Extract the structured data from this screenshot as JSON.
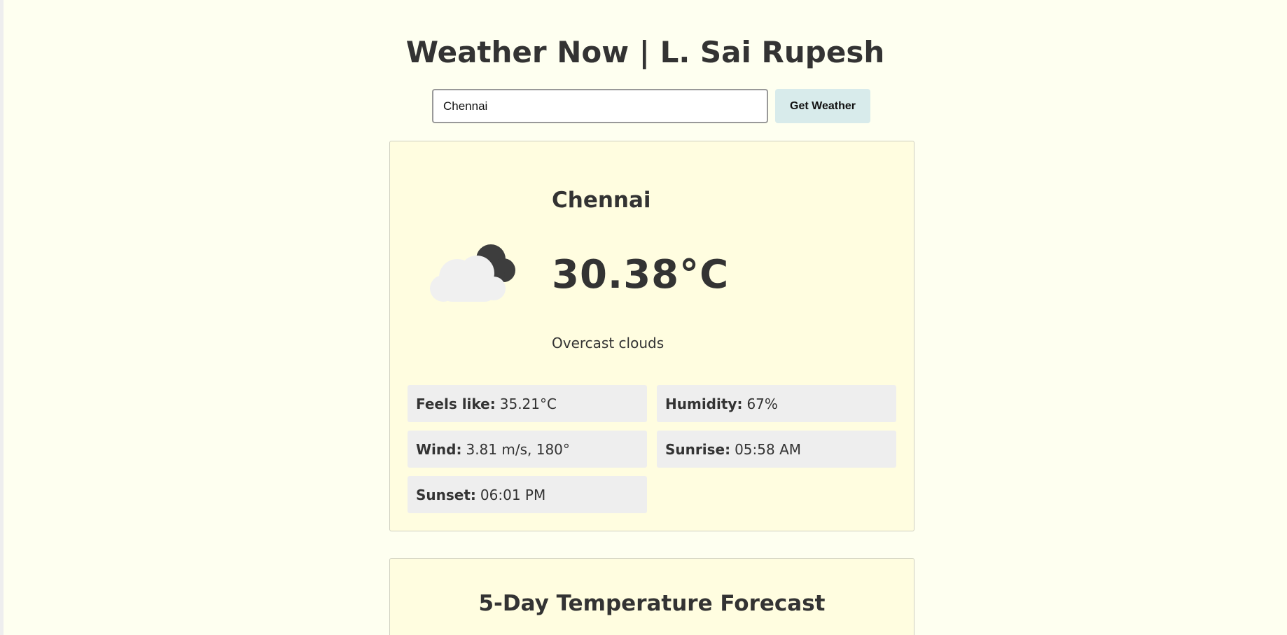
{
  "header": {
    "title": "Weather Now | L. Sai Rupesh"
  },
  "search": {
    "value": "Chennai",
    "button_label": "Get Weather"
  },
  "current": {
    "city": "Chennai",
    "temperature": "30.38°C",
    "description": "Overcast clouds",
    "icon": "overcast-clouds-icon",
    "details": [
      {
        "label": "Feels like:",
        "value": "35.21°C"
      },
      {
        "label": "Humidity:",
        "value": "67%"
      },
      {
        "label": "Wind:",
        "value": "3.81 m/s, 180°"
      },
      {
        "label": "Sunrise:",
        "value": "05:58 AM"
      },
      {
        "label": "Sunset:",
        "value": "06:01 PM"
      }
    ]
  },
  "forecast": {
    "title": "5-Day Temperature Forecast"
  },
  "colors": {
    "background": "#fefff0",
    "card": "#fffde0",
    "detail_box": "#eeeeee",
    "button": "#d8ebeb",
    "text": "#333333"
  }
}
